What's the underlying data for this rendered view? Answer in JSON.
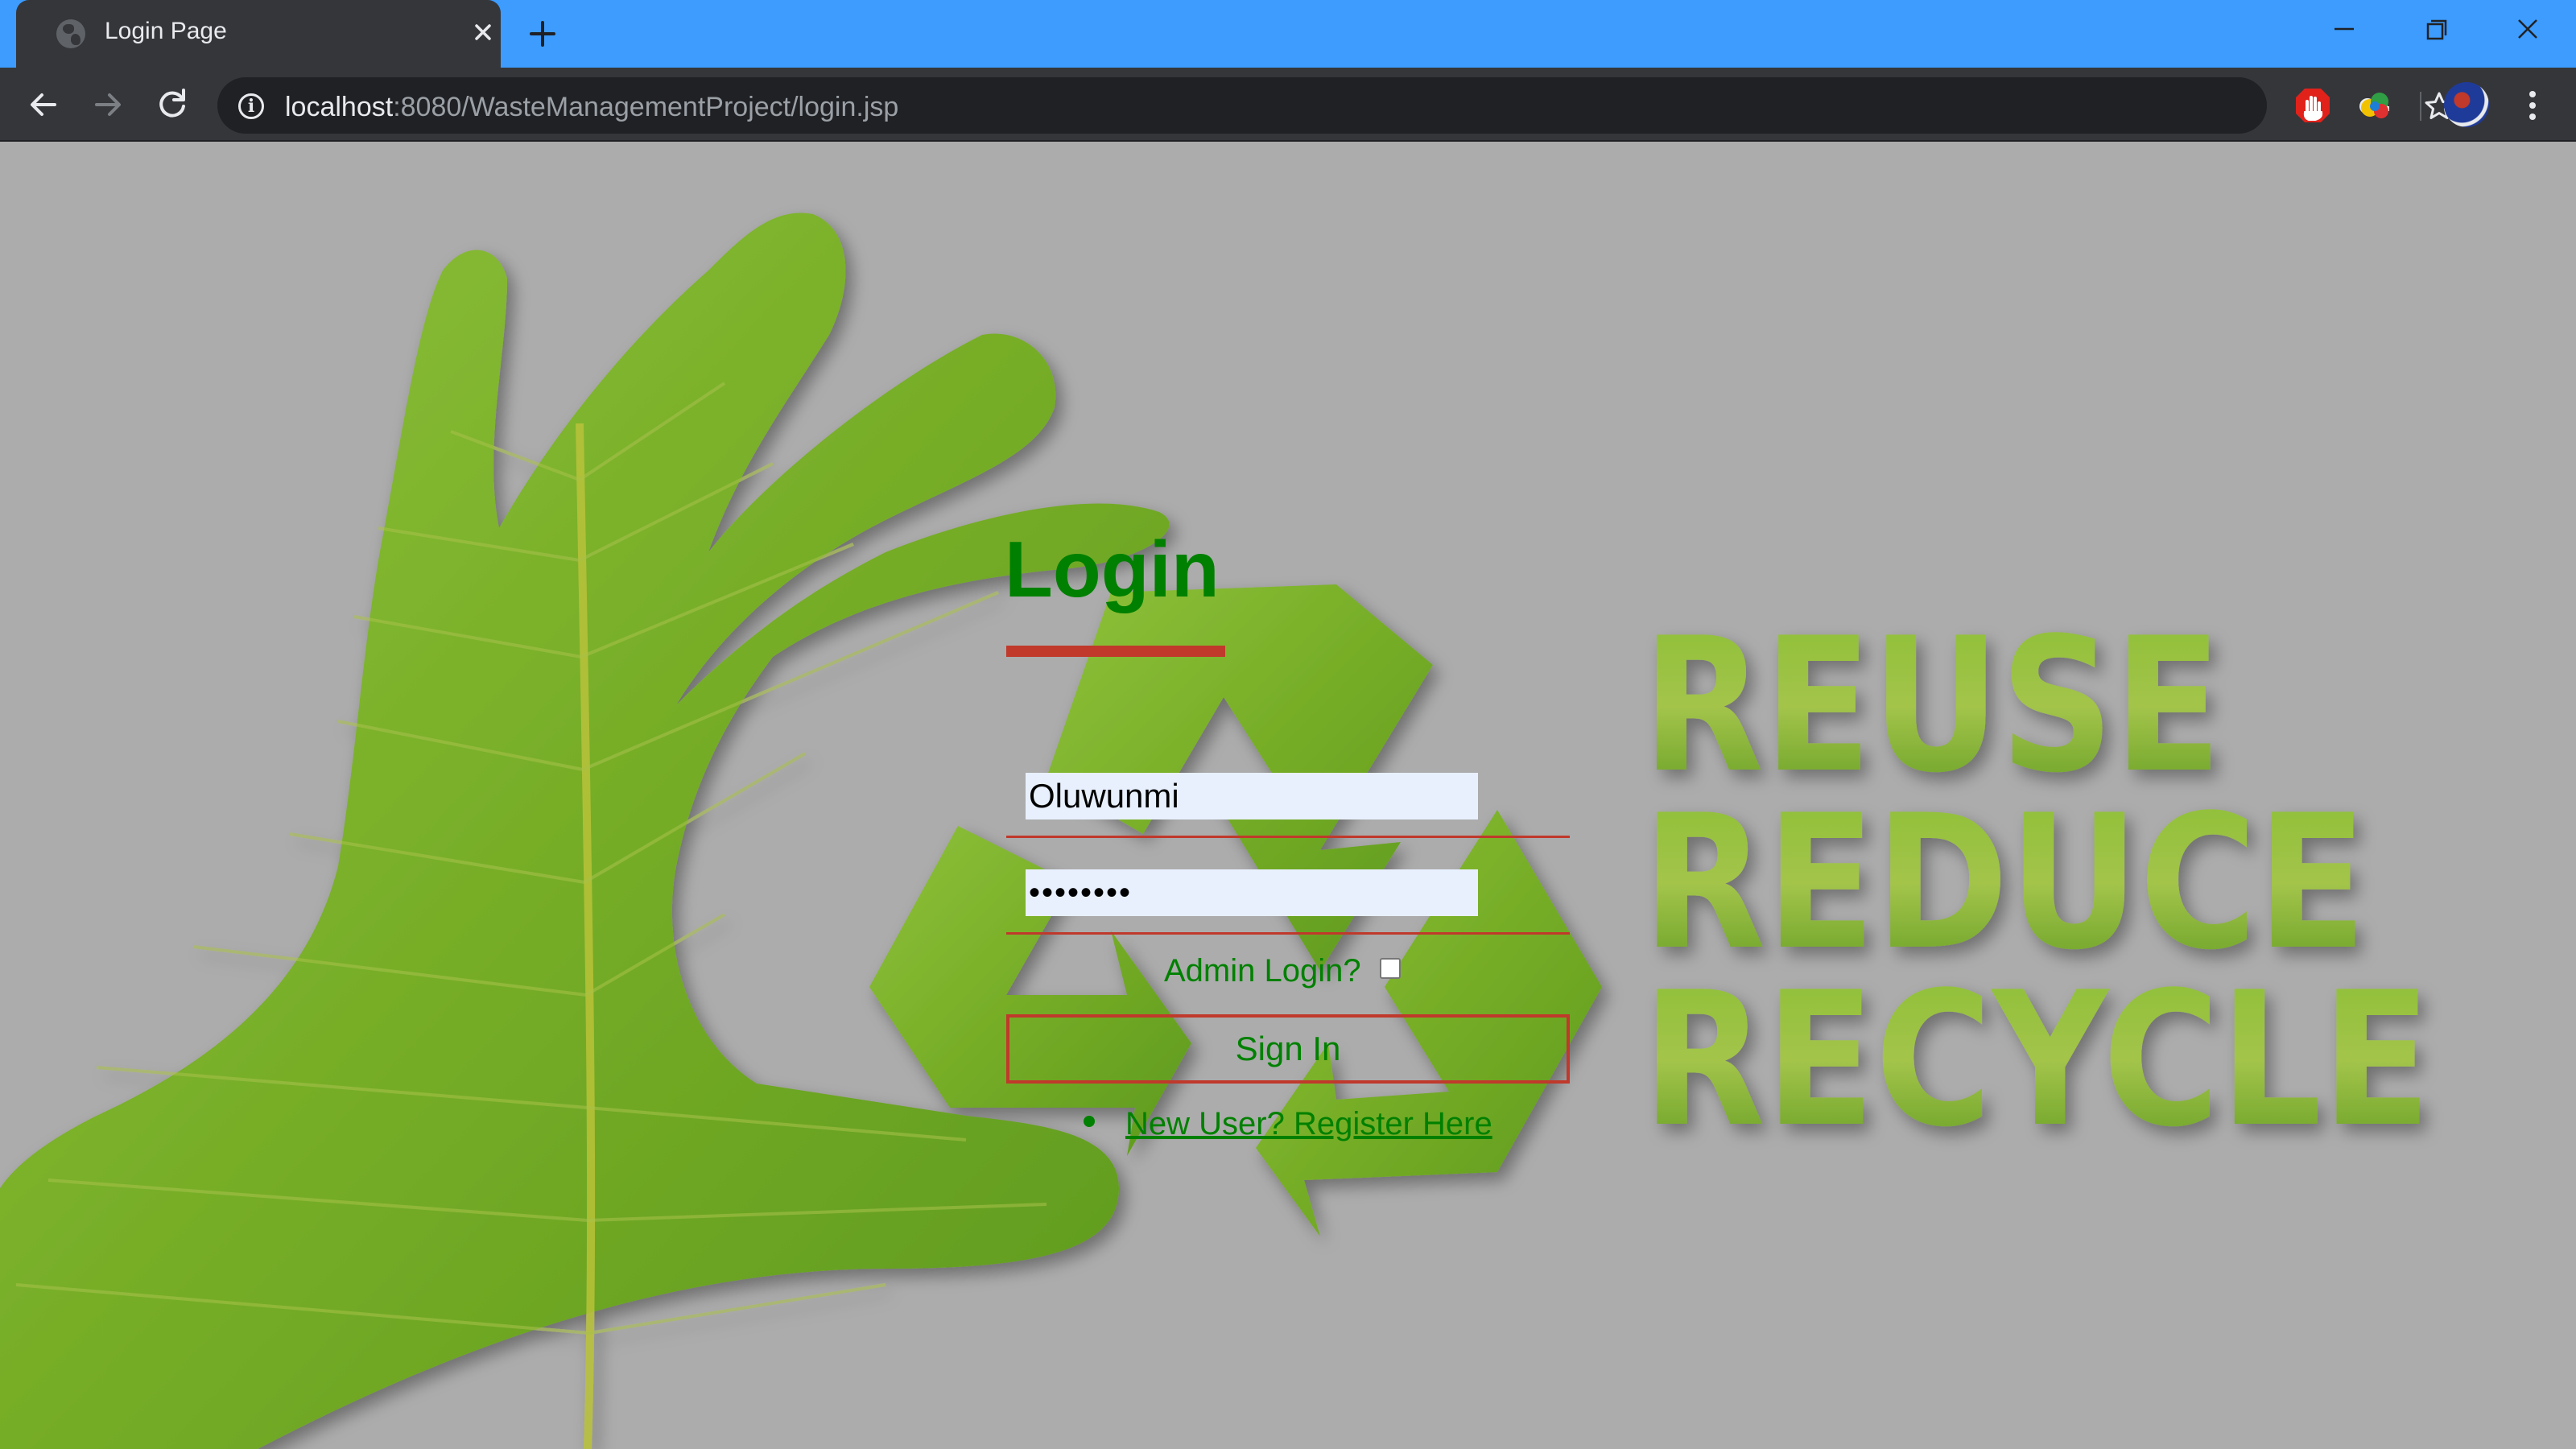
{
  "browser": {
    "tab_title": "Login Page",
    "url_host": "localhost",
    "url_path": ":8080/WasteManagementProject/login.jsp"
  },
  "page": {
    "title": "Login",
    "username_value": "Oluwunmi",
    "password_value": "••••••••",
    "admin_label": "Admin Login?",
    "admin_checked": false,
    "signin_label": "Sign In",
    "register_link": "New User? Register Here",
    "slogan": [
      "REUSE",
      "REDUCE",
      "RECYCLE"
    ]
  },
  "colors": {
    "tabstrip": "#3d9cfe",
    "toolbar": "#35363a",
    "page_background": "#acacac",
    "accent_green": "#008000",
    "accent_red": "#c0392b",
    "leaf_green": "#7bb02b"
  },
  "icons": [
    "globe-icon",
    "close-icon",
    "plus-icon",
    "minimize-icon",
    "restore-icon",
    "back-icon",
    "forward-icon",
    "reload-icon",
    "info-icon",
    "key-icon",
    "star-icon",
    "adblock-icon",
    "extension-icon",
    "profile-avatar",
    "menu-icon"
  ]
}
